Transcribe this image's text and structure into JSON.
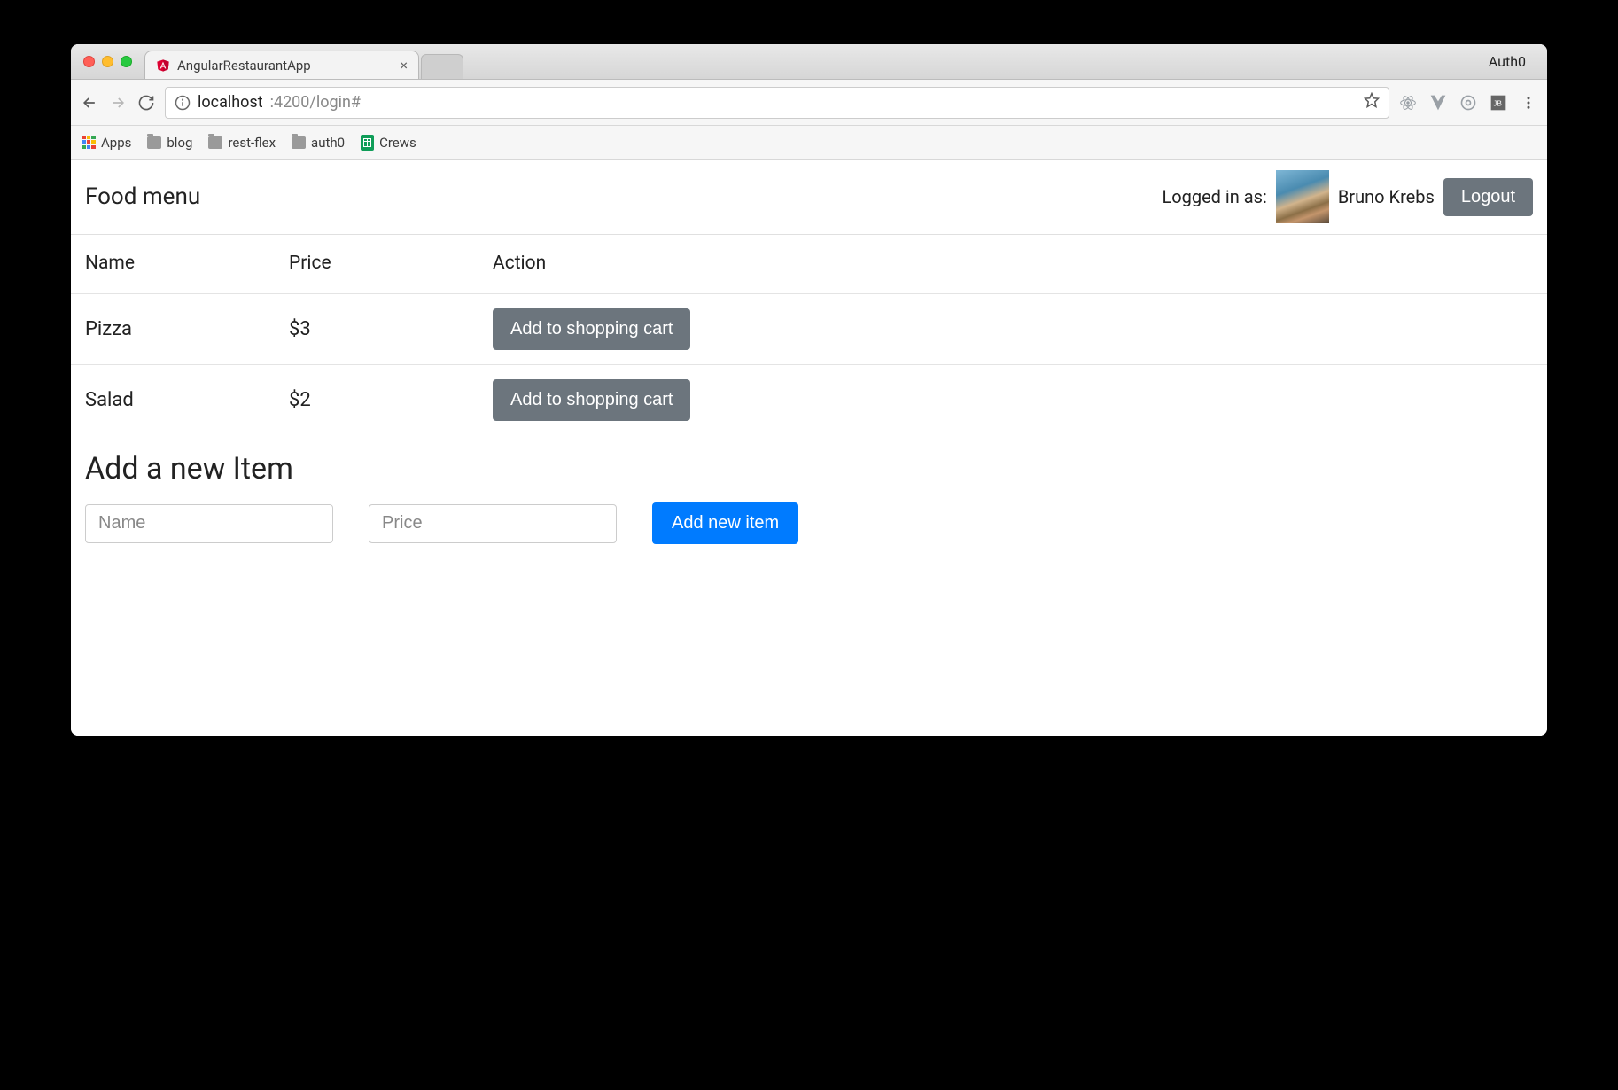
{
  "browser": {
    "tab_title": "AngularRestaurantApp",
    "profile_name": "Auth0",
    "url_host": "localhost",
    "url_path": ":4200/login#",
    "bookmarks": {
      "apps": "Apps",
      "items": [
        "blog",
        "rest-flex",
        "auth0"
      ],
      "sheets": "Crews"
    }
  },
  "header": {
    "title": "Food menu",
    "logged_in_label": "Logged in as:",
    "user_name": "Bruno Krebs",
    "logout_label": "Logout"
  },
  "table": {
    "columns": {
      "name": "Name",
      "price": "Price",
      "action": "Action"
    },
    "rows": [
      {
        "name": "Pizza",
        "price": "$3",
        "action_label": "Add to shopping cart"
      },
      {
        "name": "Salad",
        "price": "$2",
        "action_label": "Add to shopping cart"
      }
    ]
  },
  "add_form": {
    "title": "Add a new Item",
    "name_placeholder": "Name",
    "price_placeholder": "Price",
    "submit_label": "Add new item"
  }
}
